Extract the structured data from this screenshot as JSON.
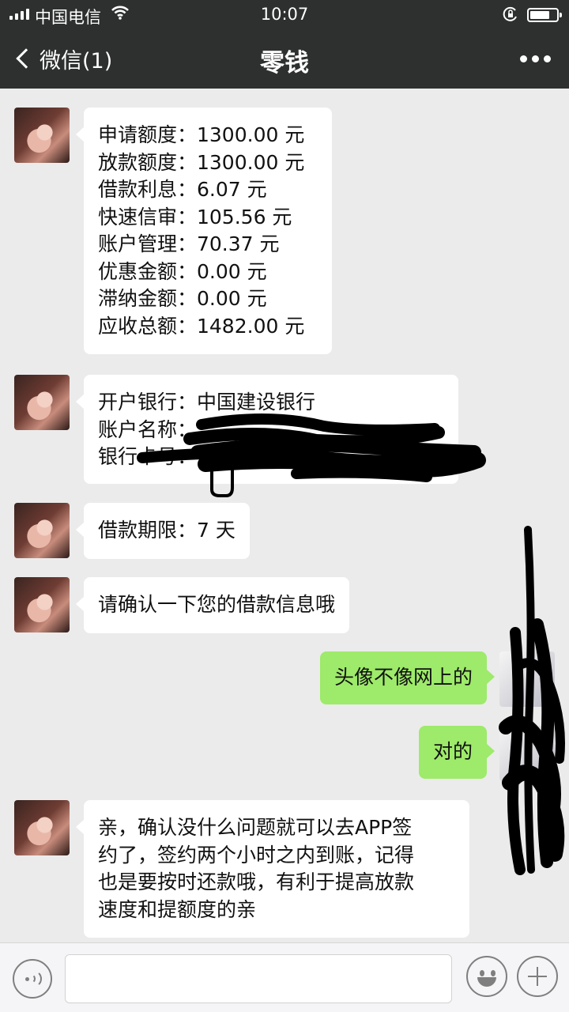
{
  "status_bar": {
    "carrier": "中国电信",
    "time": "10:07"
  },
  "nav": {
    "back_label": "微信(1)",
    "title": "零钱"
  },
  "messages": [
    {
      "side": "left",
      "text": "申请额度：1300.00 元\n放款额度：1300.00 元\n借款利息：6.07 元\n快速信审：105.56 元\n账户管理：70.37 元\n优惠金额：0.00 元\n滞纳金额：0.00 元\n应收总额：1482.00 元"
    },
    {
      "side": "left",
      "text": "开户银行：中国建设银行\n账户名称：\n银行卡号："
    },
    {
      "side": "left",
      "text": "借款期限：7 天"
    },
    {
      "side": "left",
      "text": "请确认一下您的借款信息哦"
    },
    {
      "side": "right",
      "text": "头像不像网上的"
    },
    {
      "side": "right",
      "text": "对的"
    },
    {
      "side": "left",
      "text": "亲，确认没什么问题就可以去APP签\n约了，签约两个小时之内到账，记得\n也是要按时还款哦，有利于提高放款\n速度和提额度的亲"
    }
  ],
  "colors": {
    "header_bg": "#2e302f",
    "chat_bg": "#ebebeb",
    "bubble_white": "#ffffff",
    "bubble_green": "#9eea6a",
    "redaction": "#000000"
  },
  "icons": {
    "back": "chevron-left-icon",
    "more": "more-dots-icon",
    "voice": "voice-icon",
    "emoji": "emoji-icon",
    "plus": "plus-icon"
  }
}
